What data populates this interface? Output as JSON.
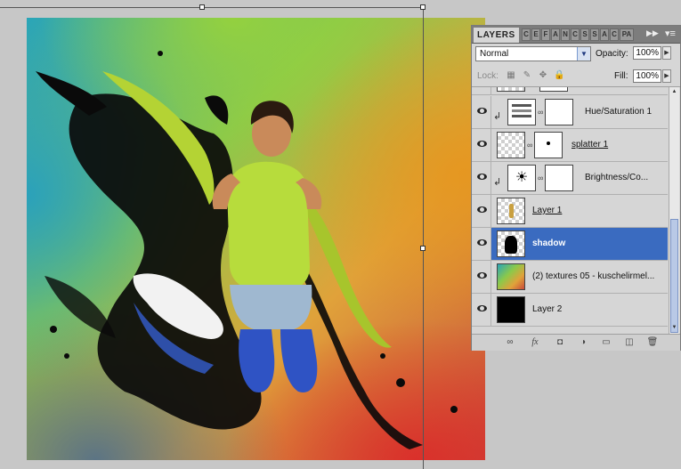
{
  "panel": {
    "tab_active": "LAYERS",
    "tabs_collapsed": [
      "C",
      "E",
      "F",
      "A",
      "N",
      "C",
      "S",
      "S",
      "A",
      "C",
      "PA"
    ],
    "blend_mode": "Normal",
    "opacity_label": "Opacity:",
    "opacity_value": "100%",
    "lock_label": "Lock:",
    "fill_label": "Fill:",
    "fill_value": "100%"
  },
  "layers": [
    {
      "name": "Hue/Saturation 1",
      "type": "adjustment",
      "icon": "hue-saturation-icon",
      "clipped": true,
      "underlined": false,
      "selected": false
    },
    {
      "name": "splatter 1",
      "type": "masked",
      "clipped": false,
      "underlined": true,
      "selected": false
    },
    {
      "name": "Brightness/Co...",
      "type": "adjustment",
      "icon": "brightness-contrast-icon",
      "clipped": true,
      "underlined": false,
      "selected": false
    },
    {
      "name": "Layer 1",
      "type": "pixel",
      "clipped": false,
      "underlined": true,
      "selected": false
    },
    {
      "name": "shadow",
      "type": "pixel",
      "clipped": false,
      "underlined": false,
      "selected": true
    },
    {
      "name": "(2) textures 05 - kuschelirmel...",
      "type": "pixel",
      "clipped": false,
      "underlined": false,
      "selected": false
    },
    {
      "name": "Layer 2",
      "type": "pixel",
      "clipped": false,
      "underlined": false,
      "selected": false
    }
  ],
  "footer_icons": [
    "link-icon",
    "fx-icon",
    "mask-icon",
    "adjustment-icon",
    "folder-icon",
    "new-layer-icon",
    "trash-icon"
  ],
  "colors": {
    "selection": "#3a6bc0",
    "panel_bg": "#d6d6d6",
    "tabbar": "#7d7d7d"
  }
}
